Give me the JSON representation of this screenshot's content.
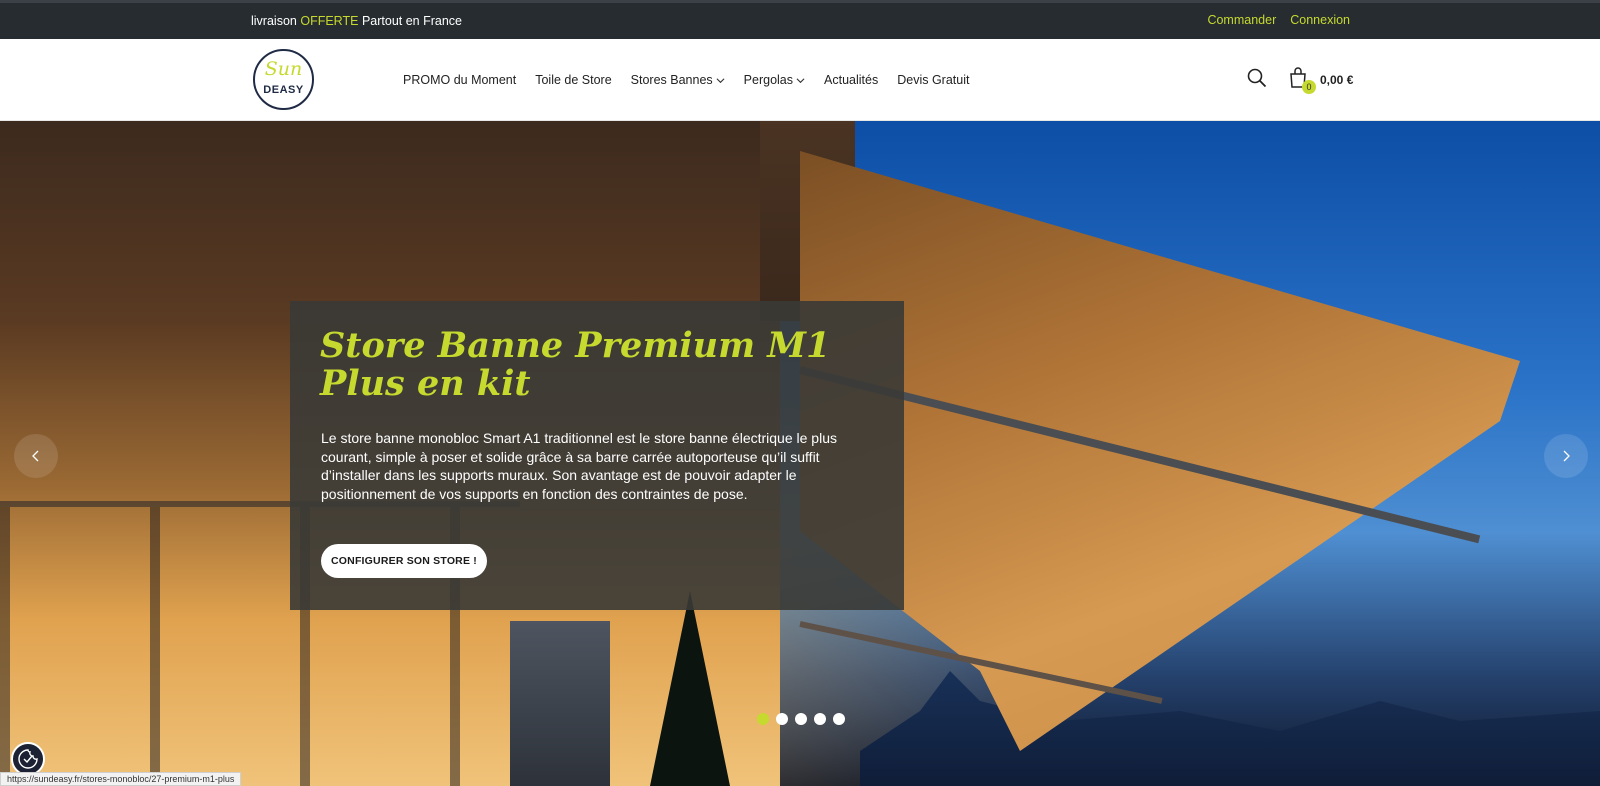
{
  "topbar": {
    "promo_prefix": "livraison",
    "promo_highlight": "OFFERTE",
    "promo_suffix": "Partout en France",
    "links": [
      "Commander",
      "Connexion"
    ]
  },
  "header": {
    "logo": {
      "line1": "Sun",
      "line2": "DEASY"
    },
    "nav": [
      {
        "label": "PROMO du Moment",
        "dropdown": false
      },
      {
        "label": "Toile de Store",
        "dropdown": false
      },
      {
        "label": "Stores Bannes",
        "dropdown": true
      },
      {
        "label": "Pergolas",
        "dropdown": true
      },
      {
        "label": "Actualités",
        "dropdown": false
      },
      {
        "label": "Devis Gratuit",
        "dropdown": false
      }
    ],
    "cart": {
      "count": "0",
      "total": "0,00 €"
    }
  },
  "hero": {
    "title": "Store Banne Premium M1 Plus en kit",
    "description": "Le store banne monobloc Smart A1 traditionnel est le store banne électrique le plus courant, simple à poser et solide grâce à sa barre carrée autoporteuse qu’il suffit d’installer dans les supports muraux. Son avantage est de pouvoir adapter le positionnement de vos supports en fonction des contraintes de pose.",
    "cta_label": "CONFIGURER SON STORE !",
    "slides_total": 5,
    "active_slide": 1
  },
  "status_url": "https://sundeasy.fr/stores-monobloc/27-premium-m1-plus",
  "colors": {
    "accent": "#c6d92e",
    "topbar_bg": "#262c30",
    "card_bg": "#3a3a36"
  },
  "icons": [
    "search-icon",
    "cart-icon",
    "chevron-left-icon",
    "chevron-right-icon",
    "chevron-down-icon",
    "cookie-settings-icon"
  ]
}
